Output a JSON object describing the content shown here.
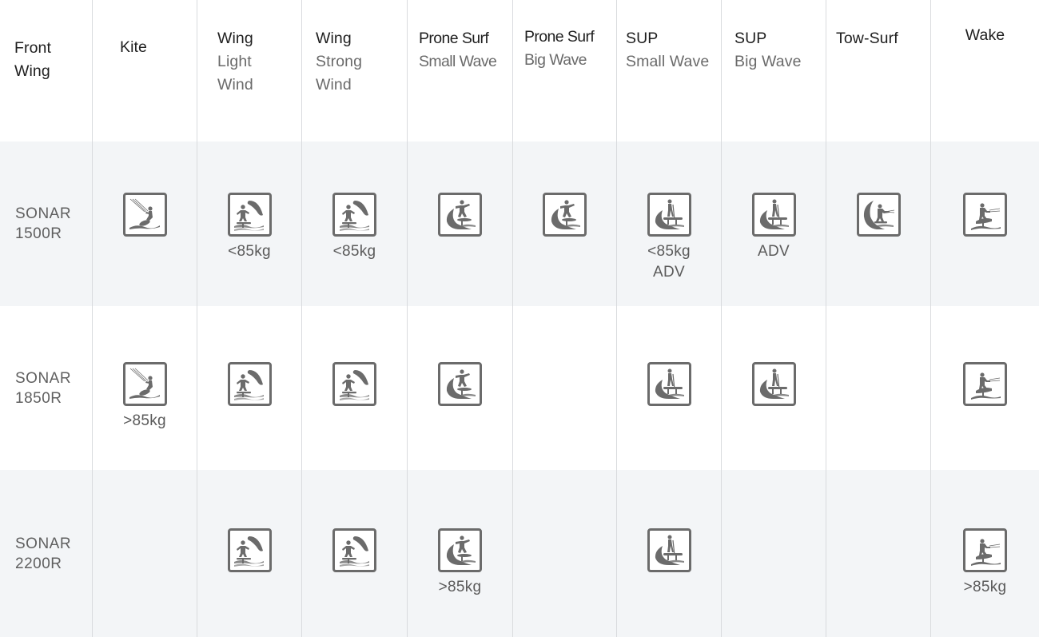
{
  "header": {
    "front_wing": [
      "Front",
      "Wing"
    ],
    "columns": [
      {
        "key": "kite",
        "title": "Kite",
        "sub": []
      },
      {
        "key": "wing-light",
        "title": "Wing",
        "sub": [
          "Light",
          "Wind"
        ]
      },
      {
        "key": "wing-strong",
        "title": "Wing",
        "sub": [
          "Strong",
          "Wind"
        ]
      },
      {
        "key": "prone-small",
        "title": "Prone Surf",
        "sub": [
          "Small Wave"
        ]
      },
      {
        "key": "prone-big",
        "title": "Prone Surf",
        "sub": [
          "Big Wave"
        ]
      },
      {
        "key": "sup-small",
        "title": "SUP",
        "sub": [
          "Small Wave"
        ]
      },
      {
        "key": "sup-big",
        "title": "SUP",
        "sub": [
          "Big Wave"
        ]
      },
      {
        "key": "tow-surf",
        "title": "Tow-Surf",
        "sub": []
      },
      {
        "key": "wake",
        "title": "Wake",
        "sub": []
      }
    ]
  },
  "colors": {
    "icon": "#6b6b6b",
    "row_shade": "#f3f5f7",
    "divider": "#d9dbde"
  },
  "rows": [
    {
      "name": [
        "SONAR",
        "1500R"
      ],
      "cells": [
        {
          "icon": "kite-icon",
          "notes": []
        },
        {
          "icon": "wing-foil-icon",
          "notes": [
            "<85kg"
          ]
        },
        {
          "icon": "wing-foil-icon",
          "notes": [
            "<85kg"
          ]
        },
        {
          "icon": "prone-surf-icon",
          "notes": []
        },
        {
          "icon": "prone-surf-icon",
          "notes": []
        },
        {
          "icon": "sup-foil-icon",
          "notes": [
            "<85kg",
            "ADV"
          ]
        },
        {
          "icon": "sup-foil-icon",
          "notes": [
            "ADV"
          ]
        },
        {
          "icon": "tow-surf-icon",
          "notes": []
        },
        {
          "icon": "wake-foil-icon",
          "notes": []
        }
      ]
    },
    {
      "name": [
        "SONAR",
        "1850R"
      ],
      "cells": [
        {
          "icon": "kite-icon",
          "notes": [
            ">85kg"
          ]
        },
        {
          "icon": "wing-foil-icon",
          "notes": []
        },
        {
          "icon": "wing-foil-icon",
          "notes": []
        },
        {
          "icon": "prone-surf-icon",
          "notes": []
        },
        {
          "icon": null,
          "notes": []
        },
        {
          "icon": "sup-foil-icon",
          "notes": []
        },
        {
          "icon": "sup-foil-icon",
          "notes": []
        },
        {
          "icon": null,
          "notes": []
        },
        {
          "icon": "wake-foil-icon",
          "notes": []
        }
      ]
    },
    {
      "name": [
        "SONAR",
        "2200R"
      ],
      "cells": [
        {
          "icon": null,
          "notes": []
        },
        {
          "icon": "wing-foil-icon",
          "notes": []
        },
        {
          "icon": "wing-foil-icon",
          "notes": []
        },
        {
          "icon": "prone-surf-icon",
          "notes": [
            ">85kg"
          ]
        },
        {
          "icon": null,
          "notes": []
        },
        {
          "icon": "sup-foil-icon",
          "notes": []
        },
        {
          "icon": null,
          "notes": []
        },
        {
          "icon": null,
          "notes": []
        },
        {
          "icon": "wake-foil-icon",
          "notes": [
            ">85kg"
          ]
        }
      ]
    }
  ]
}
